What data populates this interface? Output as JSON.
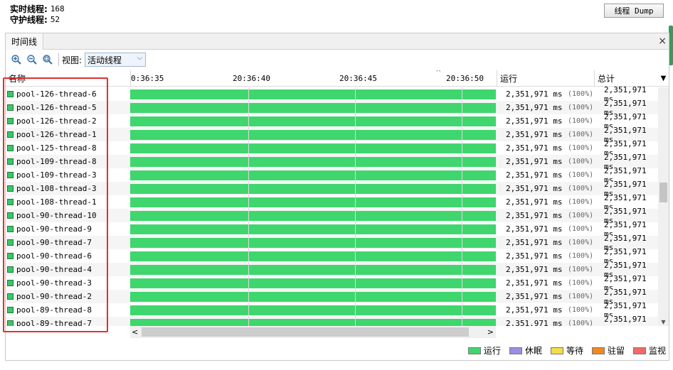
{
  "stats": {
    "live_label": "实时线程:",
    "live_value": "168",
    "daemon_label": "守护线程:",
    "daemon_value": "52"
  },
  "dump_button": "线程 Dump",
  "panel": {
    "tab": "时间线",
    "close": "×"
  },
  "toolbar": {
    "view_label": "视图:",
    "view_value": "活动线程"
  },
  "columns": {
    "name": "名称",
    "run": "运行",
    "total": "总计"
  },
  "ticks": [
    "0:36:35",
    "20:36:40",
    "20:36:45",
    "20:36:50"
  ],
  "run_fraction": 1.0,
  "threads": [
    {
      "name": "pool-126-thread-6",
      "run": "2,351,971 ms",
      "pct": "(100%)",
      "total": "2,351,971 ms"
    },
    {
      "name": "pool-126-thread-5",
      "run": "2,351,971 ms",
      "pct": "(100%)",
      "total": "2,351,971 ms"
    },
    {
      "name": "pool-126-thread-2",
      "run": "2,351,971 ms",
      "pct": "(100%)",
      "total": "2,351,971 ms"
    },
    {
      "name": "pool-126-thread-1",
      "run": "2,351,971 ms",
      "pct": "(100%)",
      "total": "2,351,971 ms"
    },
    {
      "name": "pool-125-thread-8",
      "run": "2,351,971 ms",
      "pct": "(100%)",
      "total": "2,351,971 ms"
    },
    {
      "name": "pool-109-thread-8",
      "run": "2,351,971 ms",
      "pct": "(100%)",
      "total": "2,351,971 ms"
    },
    {
      "name": "pool-109-thread-3",
      "run": "2,351,971 ms",
      "pct": "(100%)",
      "total": "2,351,971 ms"
    },
    {
      "name": "pool-108-thread-3",
      "run": "2,351,971 ms",
      "pct": "(100%)",
      "total": "2,351,971 ms"
    },
    {
      "name": "pool-108-thread-1",
      "run": "2,351,971 ms",
      "pct": "(100%)",
      "total": "2,351,971 ms"
    },
    {
      "name": "pool-90-thread-10",
      "run": "2,351,971 ms",
      "pct": "(100%)",
      "total": "2,351,971 ms"
    },
    {
      "name": "pool-90-thread-9",
      "run": "2,351,971 ms",
      "pct": "(100%)",
      "total": "2,351,971 ms"
    },
    {
      "name": "pool-90-thread-7",
      "run": "2,351,971 ms",
      "pct": "(100%)",
      "total": "2,351,971 ms"
    },
    {
      "name": "pool-90-thread-6",
      "run": "2,351,971 ms",
      "pct": "(100%)",
      "total": "2,351,971 ms"
    },
    {
      "name": "pool-90-thread-4",
      "run": "2,351,971 ms",
      "pct": "(100%)",
      "total": "2,351,971 ms"
    },
    {
      "name": "pool-90-thread-3",
      "run": "2,351,971 ms",
      "pct": "(100%)",
      "total": "2,351,971 ms"
    },
    {
      "name": "pool-90-thread-2",
      "run": "2,351,971 ms",
      "pct": "(100%)",
      "total": "2,351,971 ms"
    },
    {
      "name": "pool-89-thread-8",
      "run": "2,351,971 ms",
      "pct": "(100%)",
      "total": "2,351,971 ms"
    },
    {
      "name": "pool-89-thread-7",
      "run": "2,351,971 ms",
      "pct": "(100%)",
      "total": "2,351,971 ms"
    }
  ],
  "legend": [
    {
      "label": "运行",
      "color": "#3fd66e"
    },
    {
      "label": "休眠",
      "color": "#9a8fe0"
    },
    {
      "label": "等待",
      "color": "#f3dd4a"
    },
    {
      "label": "驻留",
      "color": "#f08a1e"
    },
    {
      "label": "监视",
      "color": "#f06a6a"
    }
  ],
  "icons": [
    "zoom-in-icon",
    "zoom-out-icon",
    "zoom-fit-icon"
  ]
}
